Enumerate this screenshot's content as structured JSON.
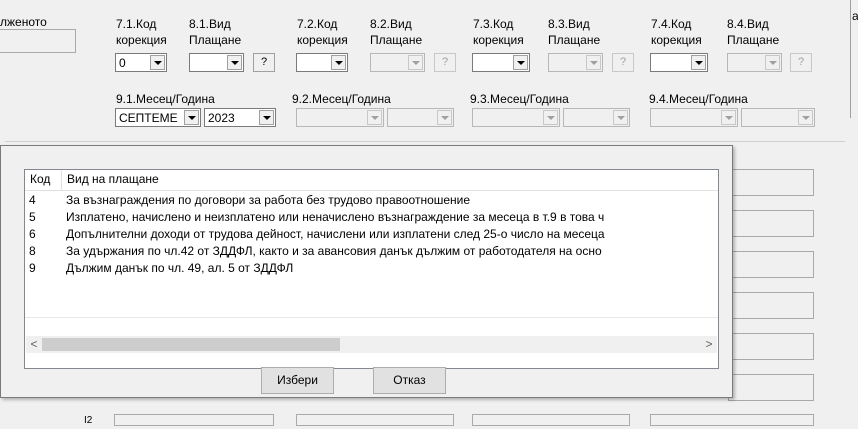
{
  "left_label": "лженото",
  "groups": [
    {
      "code_label": "7.1.Код корекция",
      "code_line1": "7.1.Код",
      "code_line2": "корекция",
      "pay_line1": "8.1.Вид",
      "pay_line2": "Плащане",
      "code_value": "0",
      "pay_value": "",
      "date_label": "9.1.Месец/Година",
      "month": "СЕПТЕМЕ",
      "year": "2023",
      "enabled": true,
      "q": "?"
    },
    {
      "code_line1": "7.2.Код",
      "code_line2": "корекция",
      "pay_line1": "8.2.Вид",
      "pay_line2": "Плащане",
      "code_value": "",
      "pay_value": "",
      "date_label": "9.2.Месец/Година",
      "month": "",
      "year": "",
      "enabled": false,
      "q": "?"
    },
    {
      "code_line1": "7.3.Код",
      "code_line2": "корекция",
      "pay_line1": "8.3.Вид",
      "pay_line2": "Плащане",
      "code_value": "",
      "pay_value": "",
      "date_label": "9.3.Месец/Година",
      "month": "",
      "year": "",
      "enabled": false,
      "q": "?"
    },
    {
      "code_line1": "7.4.Код",
      "code_line2": "корекция",
      "pay_line1": "8.4.Вид",
      "pay_line2": "Плащане",
      "code_value": "",
      "pay_value": "",
      "date_label": "9.4.Месец/Година",
      "month": "",
      "year": "",
      "enabled": false,
      "q": "?"
    }
  ],
  "right_edge_label": "а",
  "popup": {
    "columns": [
      "Код",
      "Вид на плащане"
    ],
    "rows": [
      {
        "code": "4",
        "desc": "За възнаграждения по договори за работа без трудово правоотношение"
      },
      {
        "code": "5",
        "desc": "Изплатено, начислено и неизплатено или неначислено възнаграждение за месеца в т.9 в това ч"
      },
      {
        "code": "6",
        "desc": "Допълнителни доходи от трудова дейност, начислени или изплатени след 25-о число на месеца"
      },
      {
        "code": "8",
        "desc": "За удържания по чл.42 от ЗДДФЛ, както и за авансовия данък дължим от работодателя на осно"
      },
      {
        "code": "9",
        "desc": "Дължим данък по чл. 49, ал. 5 от ЗДДФЛ"
      }
    ],
    "scroll_left": "<",
    "scroll_right": ">",
    "select_label": "Избери",
    "cancel_label": "Отказ"
  },
  "bottom_label": "I2"
}
